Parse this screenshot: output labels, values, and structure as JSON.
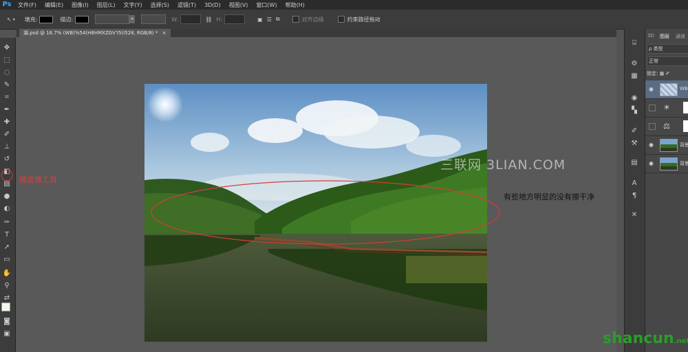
{
  "menubar": {
    "logo": "Ps",
    "items": [
      "文件(F)",
      "编辑(E)",
      "图像(I)",
      "图层(L)",
      "文字(Y)",
      "选择(S)",
      "滤镜(T)",
      "3D(D)",
      "视图(V)",
      "窗口(W)",
      "帮助(H)"
    ]
  },
  "options": {
    "fill_label": "填充:",
    "stroke_label": "描边:",
    "w_label": "W:",
    "h_label": "H:",
    "align_edges_label": "对齐边缘",
    "constrain_label": "约束路径拖动"
  },
  "document": {
    "tab_title": "湖.psd @ 16.7% (WB)%54(H8HMXZGV'I5(I528, RGB/8) *"
  },
  "annotations": {
    "tool_label": "橡皮擦工具",
    "note": "有些地方明显的没有擦干净",
    "watermark": "三联网 3LIAN.COM",
    "site_logo": "shancun",
    "site_suffix": ".net"
  },
  "layers_panel": {
    "tabs": [
      "3D",
      "图层",
      "通道"
    ],
    "filter_label": "ρ 类型",
    "blend_mode": "正常",
    "lock_label": "锁定:",
    "layers": [
      {
        "name": "WB"
      },
      {
        "name": ""
      },
      {
        "name": ""
      },
      {
        "name": "背景"
      },
      {
        "name": "背景"
      }
    ]
  },
  "colors": {
    "accent": "#31a8ff",
    "annotation_red": "#e23b3b",
    "logo_green": "#2b9d2b"
  }
}
